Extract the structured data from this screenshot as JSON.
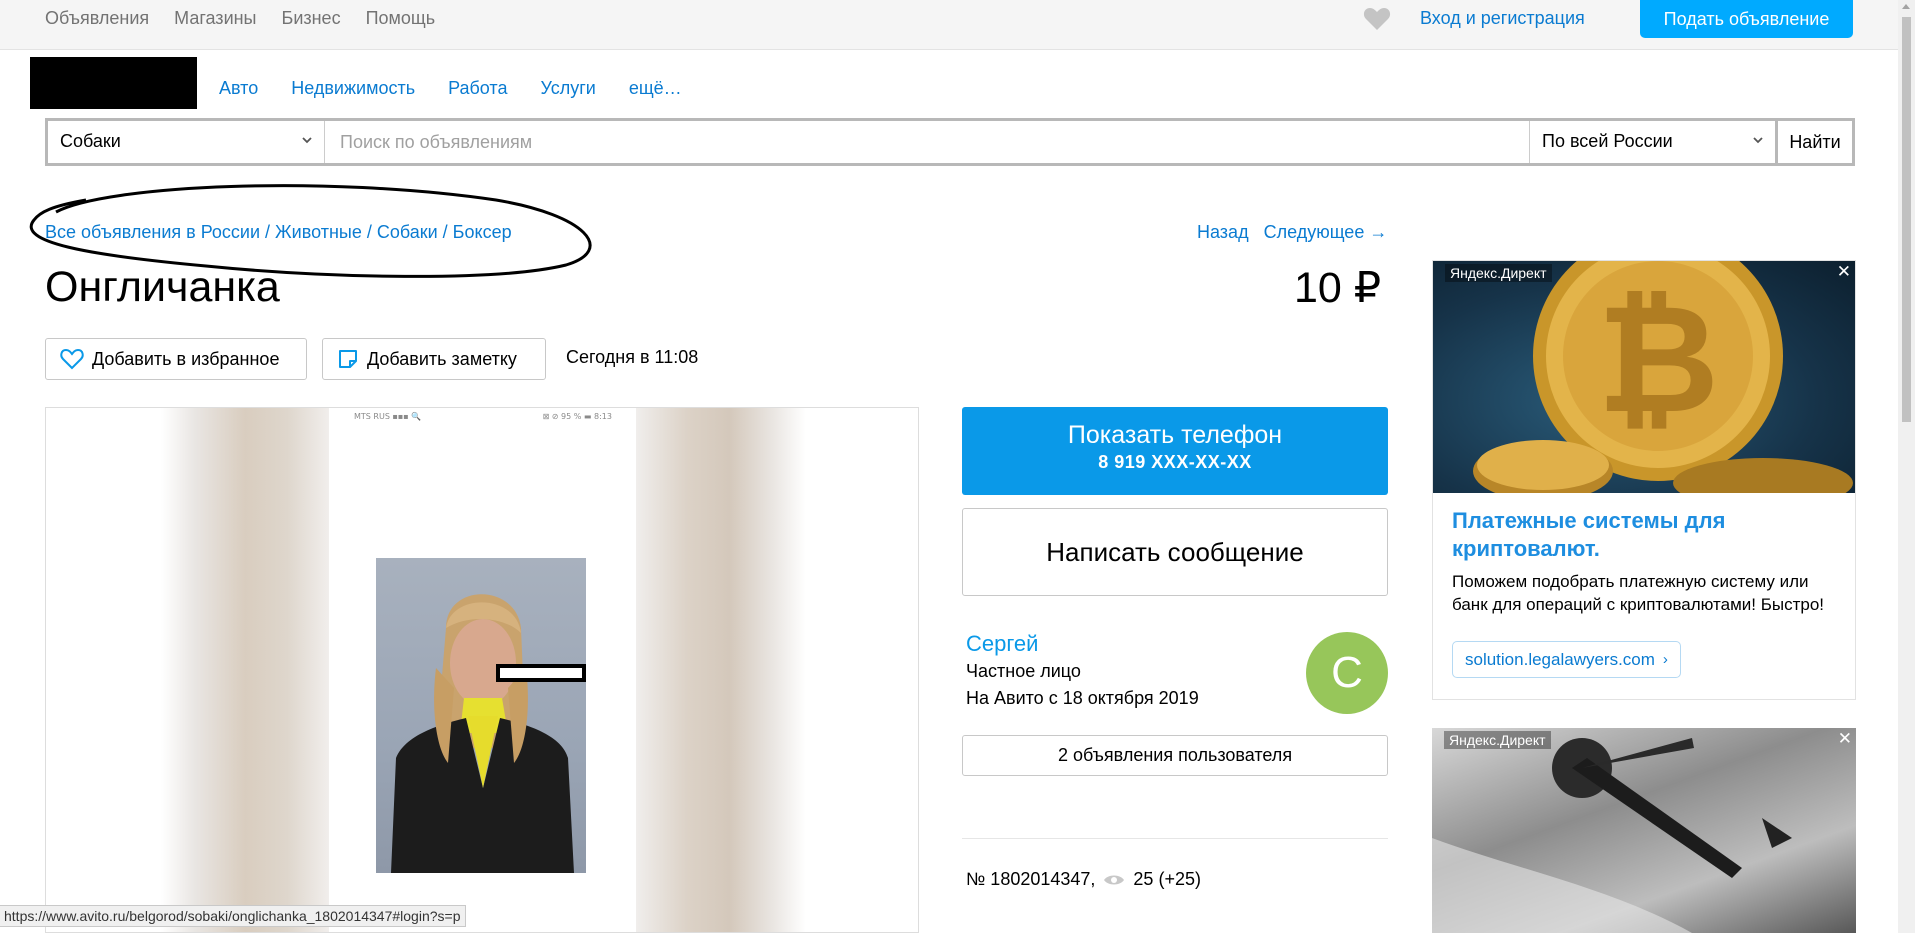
{
  "topbar": {
    "nav": [
      "Объявления",
      "Магазины",
      "Бизнес",
      "Помощь"
    ],
    "login": "Вход и регистрация",
    "post_button": "Подать объявление"
  },
  "header": {
    "categories": [
      "Авто",
      "Недвижимость",
      "Работа",
      "Услуги",
      "ещё…"
    ]
  },
  "search": {
    "category": "Собаки",
    "placeholder": "Поиск по объявлениям",
    "region": "По всей России",
    "button": "Найти"
  },
  "breadcrumb": "Все объявления в России / Животные / Собаки / Боксер",
  "navlinks": {
    "back": "Назад",
    "next": "Следующее →"
  },
  "listing": {
    "title": "Онгличанка",
    "price": "10 ₽",
    "favorite_label": "Добавить в избранное",
    "note_label": "Добавить заметку",
    "date": "Сегодня в 11:08",
    "photo_status_left": "MTS RUS ▪▪▪ 🔍",
    "photo_status_right": "⊠ ⊘ 95 % ▬ 8:13",
    "number": "№ 1802014347,",
    "views": "25 (+25)"
  },
  "contact": {
    "show_phone": "Показать телефон",
    "phone": "8 919 XXX-XX-XX",
    "write_message": "Написать сообщение",
    "seller_name": "Сергей",
    "seller_type": "Частное лицо",
    "seller_since": "На Авито с 18 октября 2019",
    "avatar_letter": "С",
    "user_ads": "2 объявления пользователя"
  },
  "ads": {
    "tag": "Яндекс.Директ",
    "ad1_heading": "Платежные системы для криптовалют.",
    "ad1_text": "Поможем подобрать платежную систему или банк для операций с криптовалютами! Быстро!",
    "ad1_url": "solution.legalawyers.com",
    "ad2_tag": "Яндекс.Директ"
  },
  "status_url": "https://www.avito.ru/belgorod/sobaki/onglichanka_1802014347#login?s=p",
  "colors": {
    "accent": "#00aaff",
    "link": "#0a7bd1",
    "avatar": "#97c65a"
  }
}
